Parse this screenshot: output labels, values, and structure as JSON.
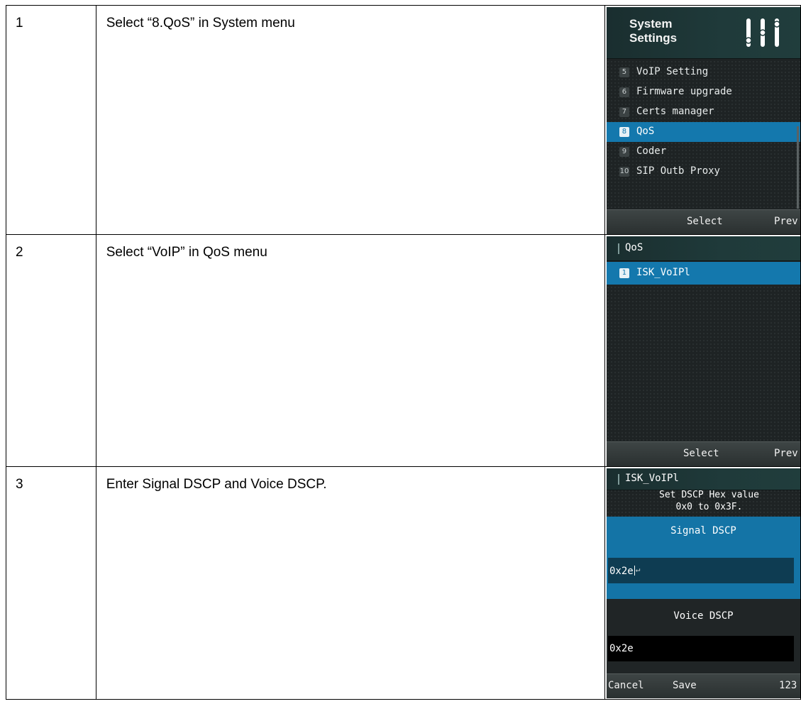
{
  "rows": [
    {
      "number": "1",
      "description": "Select “8.QoS” in System menu",
      "screen": {
        "title_line1": "System",
        "title_line2": "Settings",
        "icon": "sliders-icon",
        "menu_items": [
          {
            "index": "5",
            "label": "VoIP Setting"
          },
          {
            "index": "6",
            "label": "Firmware upgrade"
          },
          {
            "index": "7",
            "label": "Certs manager"
          },
          {
            "index": "8",
            "label": "QoS",
            "selected": true
          },
          {
            "index": "9",
            "label": "Coder"
          },
          {
            "index": "10",
            "label": "SIP Outb Proxy"
          }
        ],
        "softkeys": {
          "center": "Select",
          "right": "Prev"
        }
      }
    },
    {
      "number": "2",
      "description": "Select “VoIP” in QoS menu",
      "screen": {
        "title": "QoS",
        "menu_items": [
          {
            "index": "1",
            "label": "ISK_VoIPl",
            "selected": true
          }
        ],
        "softkeys": {
          "center": "Select",
          "right": "Prev"
        }
      }
    },
    {
      "number": "3",
      "description": "Enter Signal DSCP and Voice DSCP.",
      "screen": {
        "title": "ISK_VoIPl",
        "info_line1": "Set DSCP Hex value",
        "info_line2": "0x0 to 0x3F.",
        "signal_label": "Signal DSCP",
        "signal_value": "0x2e",
        "voice_label": "Voice DSCP",
        "voice_value": "0x2e",
        "softkeys": {
          "left": "Cancel",
          "center": "Save",
          "right": "123"
        }
      }
    }
  ],
  "colors": {
    "selection_blue": "#1478ad",
    "screen_background": "#1e2324",
    "softkey_bar": "#3a4141"
  }
}
